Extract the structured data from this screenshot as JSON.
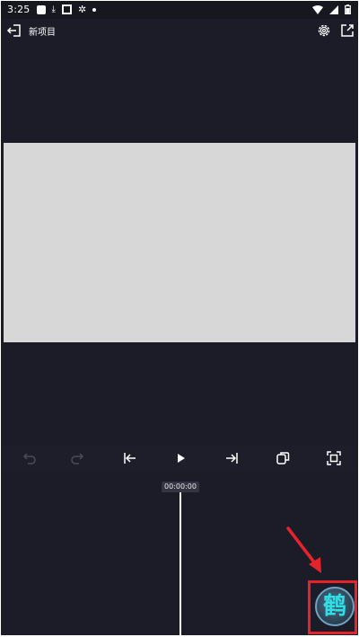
{
  "status_bar": {
    "time": "3:25",
    "left_icons": [
      "notification-square-icon",
      "download-icon",
      "stop-square-icon",
      "bug-icon",
      "dot-icon"
    ],
    "right_icons": [
      "wifi-icon",
      "signal-icon",
      "battery-icon"
    ]
  },
  "title_bar": {
    "project_title": "新项目",
    "icons": [
      "exit-icon",
      "gear-icon",
      "share-icon"
    ]
  },
  "controls": {
    "items": [
      "undo-icon",
      "redo-icon",
      "skip-to-start-icon",
      "play-icon",
      "skip-to-end-icon",
      "keyframe-icon",
      "fullscreen-icon"
    ]
  },
  "timeline": {
    "timecode": "00:00:00"
  },
  "watermark": {
    "glyph": "鹤"
  },
  "colors": {
    "background": "#1b1c27",
    "canvas": "#d7d7d7",
    "annotation": "#e5232b",
    "watermark_glyph": "#2ee0e6"
  }
}
